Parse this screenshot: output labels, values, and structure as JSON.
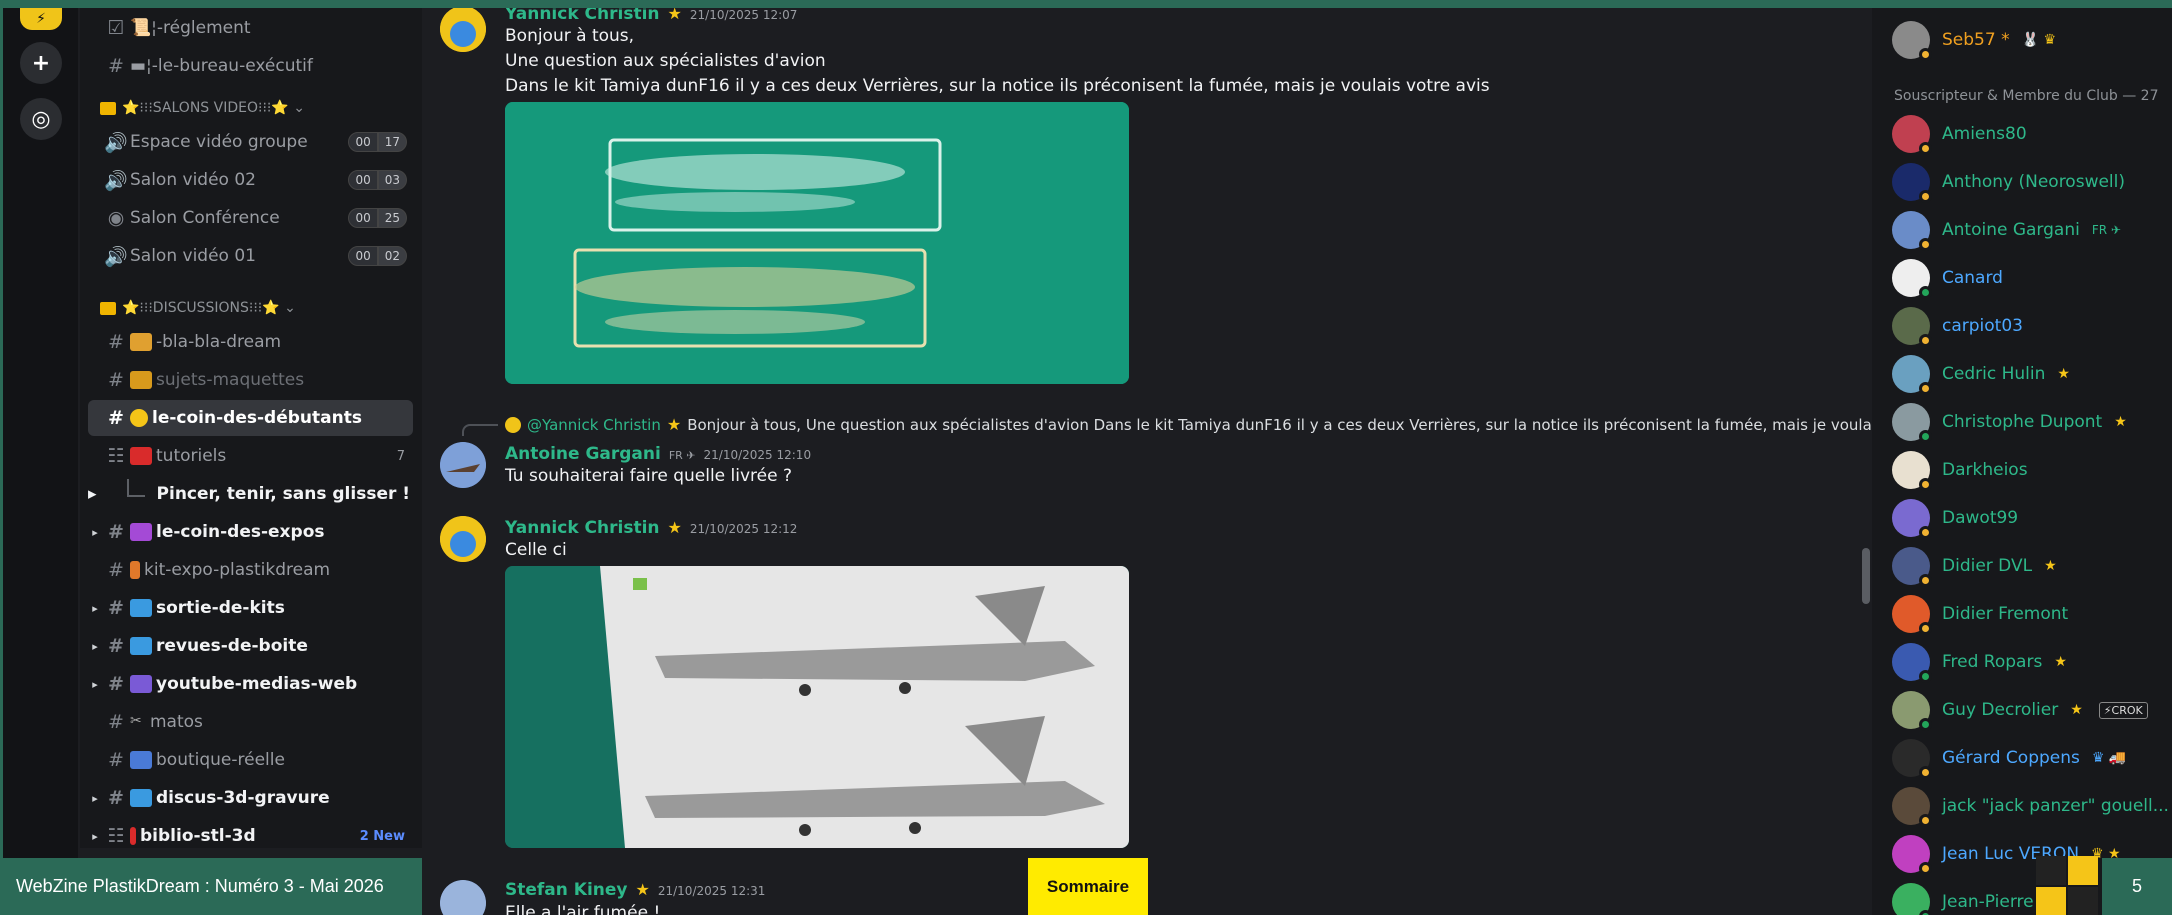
{
  "rail": {
    "add_glyph": "+",
    "discover_glyph": "◎",
    "top_label": "⚡"
  },
  "channels": {
    "top_items": [
      {
        "icon": "☑",
        "label": "📜¦-réglement"
      },
      {
        "icon": "#",
        "label": "▬¦-le-bureau-exécutif"
      }
    ],
    "cat_video": "⭐⁝⁝⁝SALONS VIDEO⁝⁝⁝⭐ ⌄",
    "voice": [
      {
        "label": "Espace vidéo groupe",
        "a": "00",
        "b": "17"
      },
      {
        "label": "Salon vidéo 02",
        "a": "00",
        "b": "03"
      },
      {
        "label": "Salon Conférence",
        "a": "00",
        "b": "25"
      },
      {
        "label": "Salon vidéo 01",
        "a": "00",
        "b": "02"
      }
    ],
    "cat_disc": "⭐⁝⁝⁝DISCUSSIONS⁝⁝⁝⭐ ⌄",
    "items": [
      {
        "label": "-bla-bla-dream"
      },
      {
        "label": "sujets-maquettes"
      },
      {
        "label": "le-coin-des-débutants"
      },
      {
        "label": "tutoriels",
        "badge": "7"
      },
      {
        "label": "Pincer, tenir, sans glisser !"
      },
      {
        "label": "le-coin-des-expos"
      },
      {
        "label": "kit-expo-plastikdream"
      },
      {
        "label": "sortie-de-kits"
      },
      {
        "label": "revues-de-boite"
      },
      {
        "label": "youtube-medias-web"
      },
      {
        "label": "matos"
      },
      {
        "label": "boutique-réelle"
      },
      {
        "label": "discus-3d-gravure"
      },
      {
        "label": "biblio-stl-3d",
        "badge": "2 New"
      }
    ]
  },
  "chat": {
    "m1": {
      "author": "Yannick Christin",
      "time": "21/10/2025 12:07",
      "lines": [
        "Bonjour à tous,",
        "Une question aux spécialistes d'avion",
        "Dans le kit Tamiya dunF16 il y a ces deux Verrières, sur la notice ils préconisent la fumée, mais je voulais votre avis"
      ]
    },
    "reply": {
      "name": "@Yannick Christin",
      "text": "Bonjour à tous, Une question aux spécialistes d'avion Dans le kit Tamiya dunF16 il y a ces deux Verrières, sur la notice ils préconisent la fumée, mais je voulais votre avis"
    },
    "m2": {
      "author": "Antoine Gargani",
      "tag": "FR ✈",
      "time": "21/10/2025 12:10",
      "line": "Tu souhaiterai faire quelle livrée ?"
    },
    "m3": {
      "author": "Yannick Christin",
      "time": "21/10/2025 12:12",
      "line": "Celle ci"
    },
    "m4": {
      "author": "Stefan Kiney",
      "time": "21/10/2025 12:31",
      "line": "Elle a l'air fumée !"
    }
  },
  "members": {
    "top": {
      "name": "Seb57 *",
      "extra": "🐰 ♛"
    },
    "category": "Souscripteur & Membre du Club — 27",
    "list": [
      {
        "name": "Amiens80"
      },
      {
        "name": "Anthony (Neoroswell)"
      },
      {
        "name": "Antoine Gargani",
        "extra": "FR ✈"
      },
      {
        "name": "Canard"
      },
      {
        "name": "carpiot03"
      },
      {
        "name": "Cedric Hulin",
        "extra": "★"
      },
      {
        "name": "Christophe Dupont",
        "extra": "★"
      },
      {
        "name": "Darkheios"
      },
      {
        "name": "Dawot99"
      },
      {
        "name": "Didier DVL",
        "extra": "★"
      },
      {
        "name": "Didier Fremont"
      },
      {
        "name": "Fred Ropars",
        "extra": "★"
      },
      {
        "name": "Guy Decrolier",
        "extra": "★",
        "crok": "⚡CROK"
      },
      {
        "name": "Gérard Coppens",
        "extra": "♛ 🚚"
      },
      {
        "name": "jack \"jack panzer\" gouell..."
      },
      {
        "name": "Jean Luc VERON",
        "extra": "♛ ★"
      },
      {
        "name": "Jean-Pierre"
      }
    ]
  },
  "footer": {
    "title": "WebZine PlastikDream : Numéro 3 - Mai 2026",
    "button": "Sommaire",
    "page": "5"
  },
  "colors": {
    "accent_green": "#2b6a57",
    "name_green": "#2eb88a",
    "name_blue": "#4da8ff",
    "button_yellow": "#ffeb00"
  }
}
